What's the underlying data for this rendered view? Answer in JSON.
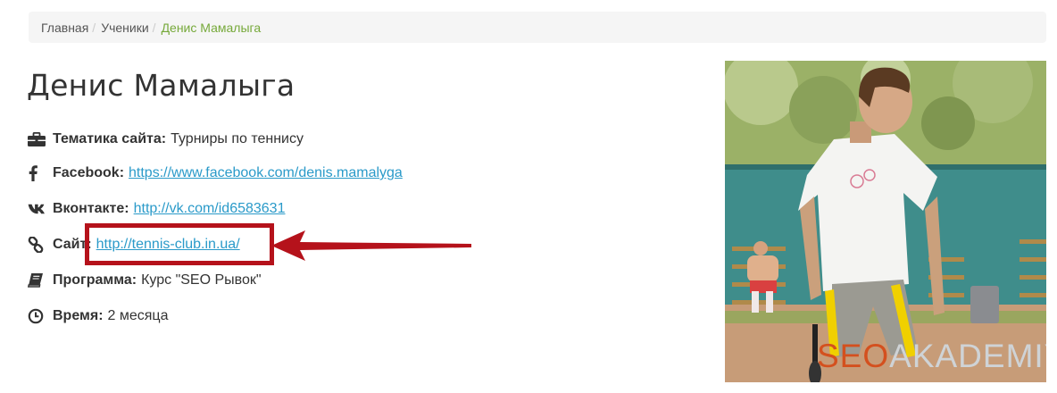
{
  "breadcrumb": {
    "items": [
      {
        "label": "Главная"
      },
      {
        "label": "Ученики"
      }
    ],
    "separator": "/",
    "active": "Денис Мамалыга"
  },
  "profile": {
    "name": "Денис Мамалыга",
    "fields": {
      "topic": {
        "icon": "briefcase-icon",
        "label": "Тематика сайта:",
        "value": "Турниры по теннису"
      },
      "facebook": {
        "icon": "facebook-icon",
        "label": "Facebook:",
        "value": "https://www.facebook.com/denis.mamalyga"
      },
      "vk": {
        "icon": "vk-icon",
        "label": "Вконтакте:",
        "value": "http://vk.com/id6583631"
      },
      "site": {
        "icon": "link-icon",
        "label": "Сайт:",
        "value": "http://tennis-club.in.ua/"
      },
      "program": {
        "icon": "book-icon",
        "label": "Программа:",
        "value": "Курс \"SEO Рывок\""
      },
      "time": {
        "icon": "clock-icon",
        "label": "Время:",
        "value": "2 месяца"
      }
    }
  },
  "watermark": {
    "part1": "SEO",
    "part2": "AKADEMIYA"
  },
  "colors": {
    "link": "#2a9ac9",
    "breadcrumb_active": "#76a93a",
    "highlight": "#b5121b",
    "watermark_accent": "#d4501e"
  }
}
